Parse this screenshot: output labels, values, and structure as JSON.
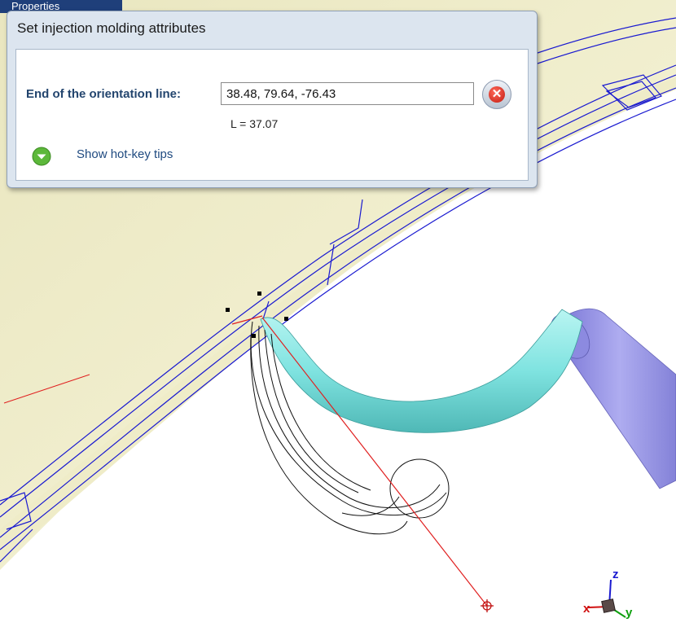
{
  "background_tab": {
    "label": "Properties"
  },
  "dialog": {
    "title": "Set injection molding attributes",
    "field_label": "End of the orientation line:",
    "field_value": "38.48, 79.64, -76.43",
    "clear_icon": "close-icon",
    "length_readout": "L = 37.07",
    "hotkey_toggle_icon": "chevron-down-icon",
    "hotkey_link": "Show hot-key tips"
  },
  "triad": {
    "z": "z",
    "y": "y",
    "x": "x"
  },
  "colors": {
    "part_face": "#f6f3d2",
    "edge_lines": "#1a1ad0",
    "runner": "#7fe3e0",
    "sprue": "#9a98e8",
    "orientation_line": "#e02020",
    "accent_blue": "#23456e"
  }
}
